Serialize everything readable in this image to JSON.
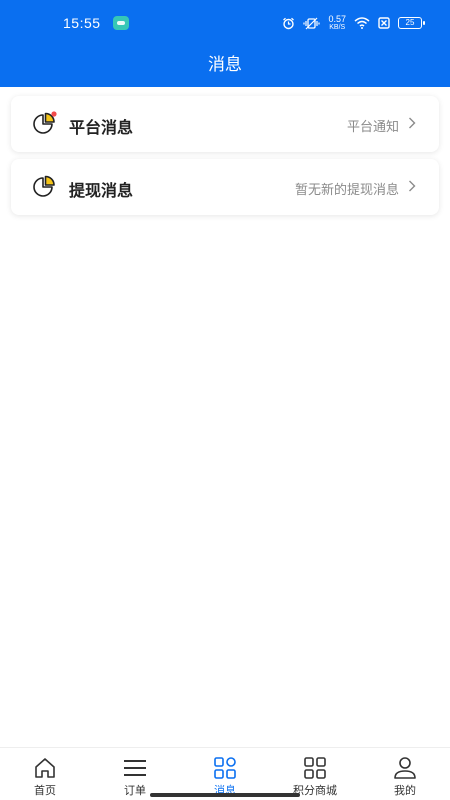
{
  "status_bar": {
    "time": "15:55",
    "network_speed": "0.57",
    "network_speed_unit": "KB/S",
    "battery": "25"
  },
  "header": {
    "title": "消息"
  },
  "messages": [
    {
      "title": "平台消息",
      "subtitle": "平台通知",
      "has_badge": true,
      "icon": "pie-chart-icon"
    },
    {
      "title": "提现消息",
      "subtitle": "暂无新的提现消息",
      "has_badge": false,
      "icon": "pie-chart-icon"
    }
  ],
  "tabs": [
    {
      "label": "首页",
      "icon": "home-icon"
    },
    {
      "label": "订单",
      "icon": "list-icon"
    },
    {
      "label": "消息",
      "icon": "grid-icon",
      "active": true
    },
    {
      "label": "积分商城",
      "icon": "grid-icon"
    },
    {
      "label": "我的",
      "icon": "person-icon"
    }
  ],
  "colors": {
    "primary": "#0a6ff0",
    "accent_yellow": "#f5c518",
    "badge_red": "#f24b4b"
  }
}
